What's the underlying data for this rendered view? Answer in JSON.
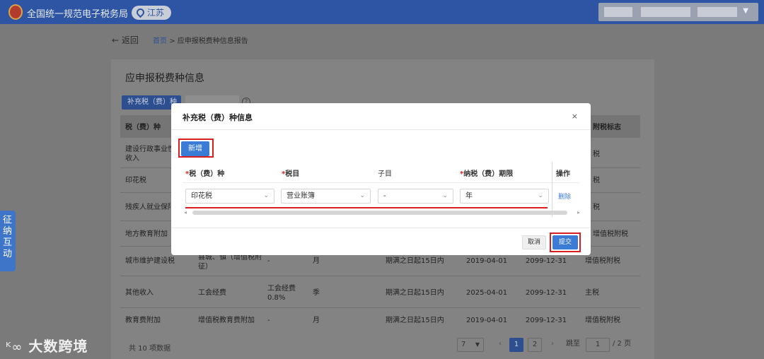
{
  "header": {
    "site_name": "全国统一规范电子税务局",
    "region": "江苏"
  },
  "nav": {
    "back_label": "返回",
    "breadcrumb_home": "首页",
    "breadcrumb_sep": ">",
    "breadcrumb_current": "应申报税费种信息报告"
  },
  "panel": {
    "title": "应申报税费种信息",
    "supplement_button": "补充税（费）种",
    "help_glyph": "?",
    "table_header_first": "税（费）种",
    "table_header_last": "附税标志",
    "rows": [
      {
        "name": "建设行政事业性收入",
        "flag": "税"
      },
      {
        "name": "印花税",
        "flag": "税"
      },
      {
        "name": "残疾人就业保障",
        "flag": "税"
      },
      {
        "name": "地方教育附加",
        "flag": "增值税附税"
      },
      {
        "name": "城市维护建设税",
        "item": "县城、镇（增值税附征）",
        "sub": "-",
        "period": "月",
        "deadline": "期满之日起15日内",
        "start": "2019-04-01",
        "end": "2099-12-31",
        "flag": "增值税附税"
      },
      {
        "name": "其他收入",
        "item": "工会经费",
        "sub": "工会经费0.8%",
        "period": "季",
        "deadline": "期满之日起15日内",
        "start": "2025-04-01",
        "end": "2099-12-31",
        "flag": "主税"
      },
      {
        "name": "教育费附加",
        "item": "增值税教育费附加",
        "sub": "-",
        "period": "月",
        "deadline": "期满之日起15日内",
        "start": "2019-04-01",
        "end": "2099-12-31",
        "flag": "增值税附税"
      }
    ],
    "total_text": "共 10 项数据",
    "page_size": "7",
    "pages": [
      "1",
      "2"
    ],
    "current_page": "1",
    "goto_label": "跳至",
    "goto_value": "1",
    "total_pages": "/ 2 页"
  },
  "side_tab": {
    "label": "征纳互动"
  },
  "watermark": {
    "text": "大数跨境"
  },
  "modal": {
    "title": "补充税（费）种信息",
    "close_glyph": "×",
    "add_button": "新增",
    "columns": {
      "tax_type": "税（费）种",
      "tax_item": "税目",
      "sub_item": "子目",
      "period": "纳税（费）期限",
      "action": "操作"
    },
    "required_mark": "*",
    "row": {
      "tax_type": "印花税",
      "tax_item": "营业账簿",
      "sub_item": "-",
      "period": "年",
      "delete": "删除"
    },
    "cancel_button": "取消",
    "submit_button": "提交"
  },
  "colors": {
    "brand_blue": "#2d55a3",
    "primary_button": "#3a7bd5",
    "highlight_red": "#d81e1e",
    "overlay_gray": "#7a7a7a"
  }
}
